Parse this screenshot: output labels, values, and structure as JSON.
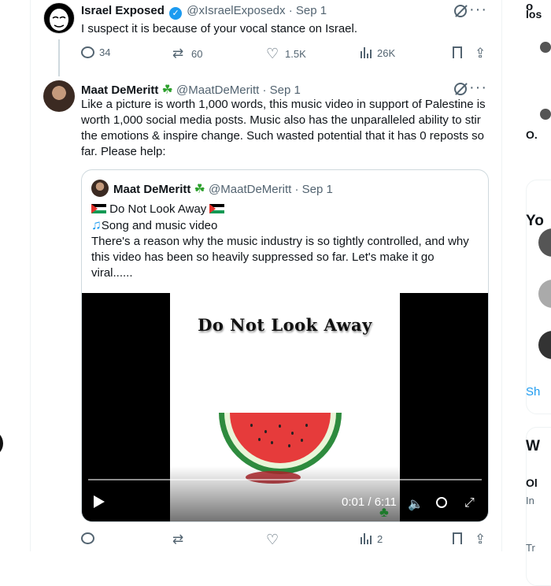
{
  "tweet1": {
    "name": "Israel Exposed",
    "handle": "@xIsraelExposedx",
    "time": "· Sep 1",
    "text": "I suspect it is because of your vocal stance on Israel.",
    "stats": {
      "replies": "34",
      "reposts": "60",
      "likes": "1.5K",
      "views": "26K"
    },
    "icons": [
      "reply-icon",
      "repost-icon",
      "like-icon",
      "views-icon",
      "bookmark-icon",
      "share-icon"
    ]
  },
  "tweet2": {
    "name": "Maat DeMeritt",
    "handle": "@MaatDeMeritt",
    "time": "· Sep 1",
    "text": "Like a picture is worth 1,000 words, this music video in support of Palestine is worth 1,000 social media posts. Music also has the unparalleled ability to stir the emotions & inspire change. Such wasted potential that it has 0 reposts so far. Please help:",
    "stats": {
      "replies": "",
      "reposts": "",
      "likes": "",
      "views": "2"
    }
  },
  "quote": {
    "name": "Maat DeMeritt",
    "handle": "@MaatDeMeritt",
    "time": "· Sep 1",
    "line1": "Do Not Look Away",
    "line2": "Song and music video",
    "line3": "There's a reason why the music industry is so tightly controlled, and why this video has been so heavily suppressed so far. Let's make it go viral......"
  },
  "video": {
    "title": "Do Not Look Away",
    "current": "0:01",
    "separator": " / ",
    "duration": "6:11",
    "progress": 0.003
  },
  "sidebar": {
    "fragments": [
      "o",
      "los",
      "O.",
      "Yo",
      "Sh",
      "W",
      "Ol",
      "In",
      "Tr"
    ]
  }
}
